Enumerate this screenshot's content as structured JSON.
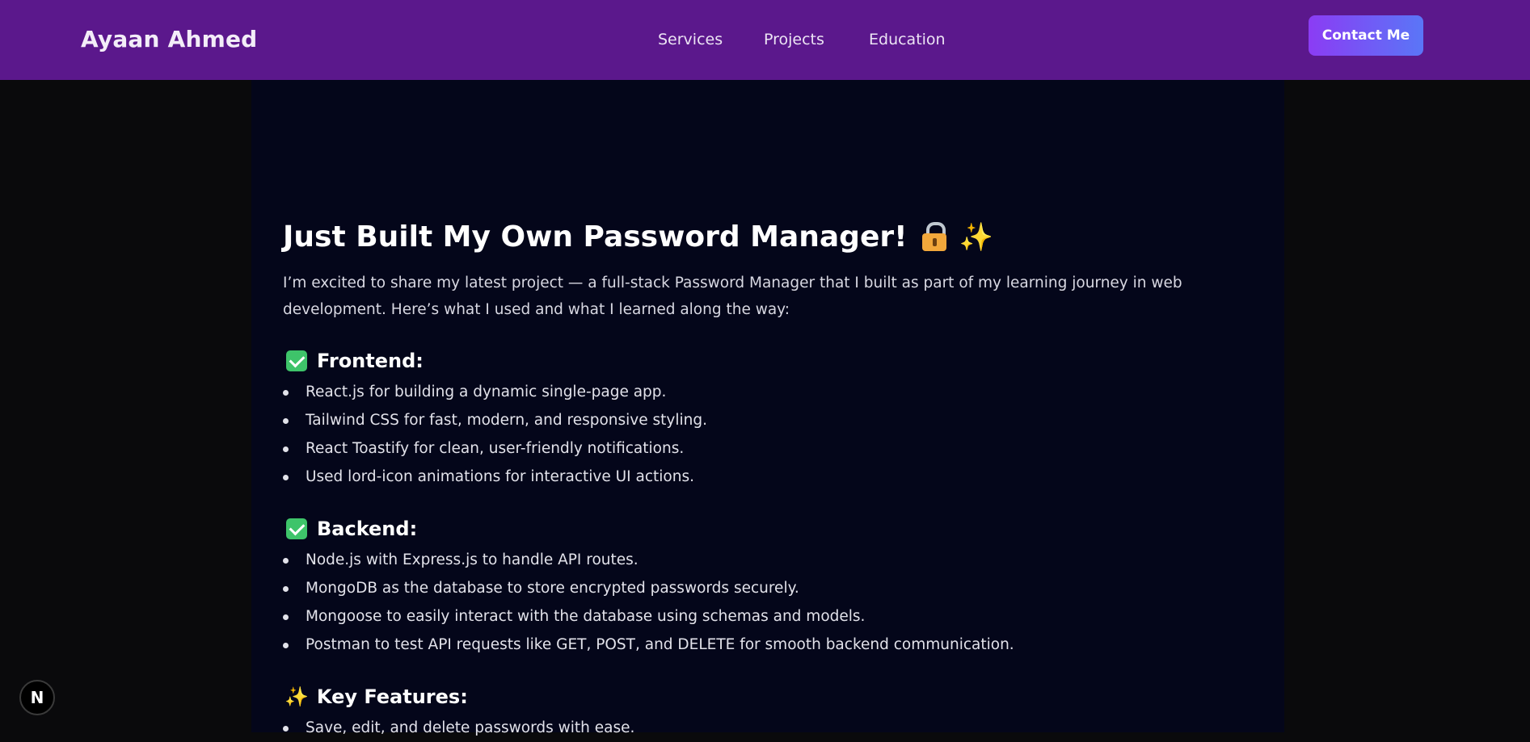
{
  "header": {
    "brand": "Ayaan Ahmed",
    "nav": [
      "Services",
      "Projects",
      "Education"
    ],
    "contact_label": "Contact Me"
  },
  "article": {
    "title": "Just Built My Own Password Manager!",
    "title_emojis": [
      "lock-icon",
      "sparkles-icon"
    ],
    "intro": "I’m excited to share my latest project — a full-stack Password Manager that I built as part of my learning journey in web development. Here’s what I used and what I learned along the way:",
    "sections": [
      {
        "icon": "check-icon",
        "title": "Frontend:",
        "items": [
          "React.js for building a dynamic single-page app.",
          "Tailwind CSS for fast, modern, and responsive styling.",
          "React Toastify for clean, user-friendly notifications.",
          "Used lord-icon animations for interactive UI actions."
        ]
      },
      {
        "icon": "check-icon",
        "title": "Backend:",
        "items": [
          "Node.js with Express.js to handle API routes.",
          "MongoDB as the database to store encrypted passwords securely.",
          "Mongoose to easily interact with the database using schemas and models.",
          "Postman to test API requests like GET, POST, and DELETE for smooth backend communication."
        ]
      },
      {
        "icon": "sparkles-icon",
        "title": "Key Features:",
        "items": [
          "Save, edit, and delete passwords with ease."
        ]
      }
    ]
  },
  "badge": {
    "label": "N",
    "icon": "nextjs-icon"
  },
  "colors": {
    "navbar": "#5b188c",
    "panel": "#04061a",
    "page": "#0a0a0c",
    "button_gradient_start": "#8b3cf4",
    "button_gradient_end": "#5a76f7"
  }
}
